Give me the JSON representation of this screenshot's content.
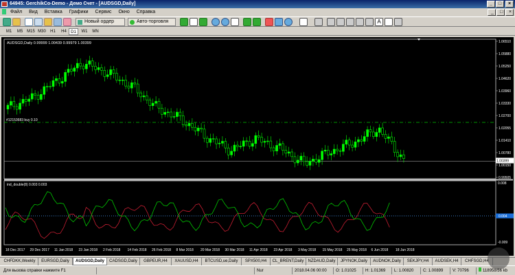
{
  "window": {
    "title": "64945: GerchikCo-Demo - Демо Счет - [AUDSGD,Daily]"
  },
  "menu": [
    "Файл",
    "Вид",
    "Вставка",
    "Графики",
    "Сервис",
    "Окно",
    "Справка"
  ],
  "toolbar": {
    "new_order": "Новый ордер",
    "auto_trading": "Авто-торговля"
  },
  "timeframes": [
    "M1",
    "M5",
    "M15",
    "M30",
    "H1",
    "H4",
    "D1",
    "W1",
    "MN"
  ],
  "active_timeframe": "D1",
  "chart": {
    "symbol_info": "AUDSGD,Daily  0.99999 1.00439 0.99979 1.00399",
    "order_label": "#12153683 buy 0.10",
    "indicator_label": "ind_double(8) 0.003 0.003",
    "current_price": "1.00399",
    "indicator_current": "0.004",
    "price_ticks": [
      "1.06510",
      "1.05880",
      "1.05250",
      "1.04620",
      "1.03960",
      "1.03330",
      "1.02700",
      "1.02055",
      "1.01410",
      "1.00780",
      "1.00150",
      "0.99505"
    ],
    "indicator_ticks": [
      "0.008",
      "-0.009"
    ],
    "date_ticks": [
      "18 Dec 2017",
      "29 Dec 2017",
      "11 Jan 2018",
      "23 Jan 2018",
      "2 Feb 2018",
      "14 Feb 2018",
      "26 Feb 2018",
      "8 Mar 2018",
      "20 Mar 2018",
      "30 Mar 2018",
      "11 Apr 2018",
      "23 Apr 2018",
      "3 May 2018",
      "15 May 2018",
      "25 May 2018",
      "6 Jun 2018",
      "18 Jun 2018"
    ],
    "colors": {
      "background": "#000000",
      "bull": "#00ff00",
      "bear": "#00ff00",
      "line_green": "#00c800",
      "line_red": "#c81e32",
      "order_line": "#00c800"
    }
  },
  "chart_data": {
    "type": "candlestick",
    "symbol": "AUDSGD",
    "x": [
      "18 Dec 2017",
      "29 Dec 2017",
      "11 Jan 2018",
      "23 Jan 2018",
      "2 Feb 2018",
      "14 Feb 2018",
      "26 Feb 2018",
      "8 Mar 2018",
      "20 Mar 2018",
      "30 Mar 2018",
      "11 Apr 2018",
      "23 Apr 2018",
      "3 May 2018",
      "15 May 2018",
      "25 May 2018",
      "6 Jun 2018",
      "18 Jun 2018"
    ],
    "close": [
      1.031,
      1.036,
      1.045,
      1.054,
      1.049,
      1.042,
      1.031,
      1.025,
      1.016,
      1.009,
      1.015,
      1.01,
      1.002,
      1.008,
      1.013,
      1.02,
      1.004
    ],
    "ylim": [
      0.99505,
      1.0651
    ],
    "order_price": 1.023,
    "indicator": {
      "name": "ind_double(8)",
      "values": [
        0.003,
        0.003
      ]
    }
  },
  "tabs": [
    "CHFDKK,Weekly",
    "EURSGD,Daily",
    "AUDSGD,Daily",
    "CADSGD,Daily",
    "GBPEUR,H4",
    "XAUUSD,H4",
    "BTCUSD,ue,Daily",
    "SPX500,H4",
    "CL_BRENT,Daily",
    "NZDAUD,Daily",
    "JPYNOK,Daily",
    "AUDNOK,Daily",
    "SEKJPY,H4",
    "AUDSEK,H4",
    "CHFSGD,H4"
  ],
  "active_tab": "AUDSGD,Daily",
  "status": {
    "help": "Для вызова справки нажмите F1",
    "profile": "Nur",
    "time": "2018.04.06 00:00",
    "open": "O: 1.01025",
    "high": "H: 1.01369",
    "low": "L: 1.00820",
    "close": "C: 1.00899",
    "volume": "V: 70796",
    "traffic": "118958/56 kb"
  }
}
